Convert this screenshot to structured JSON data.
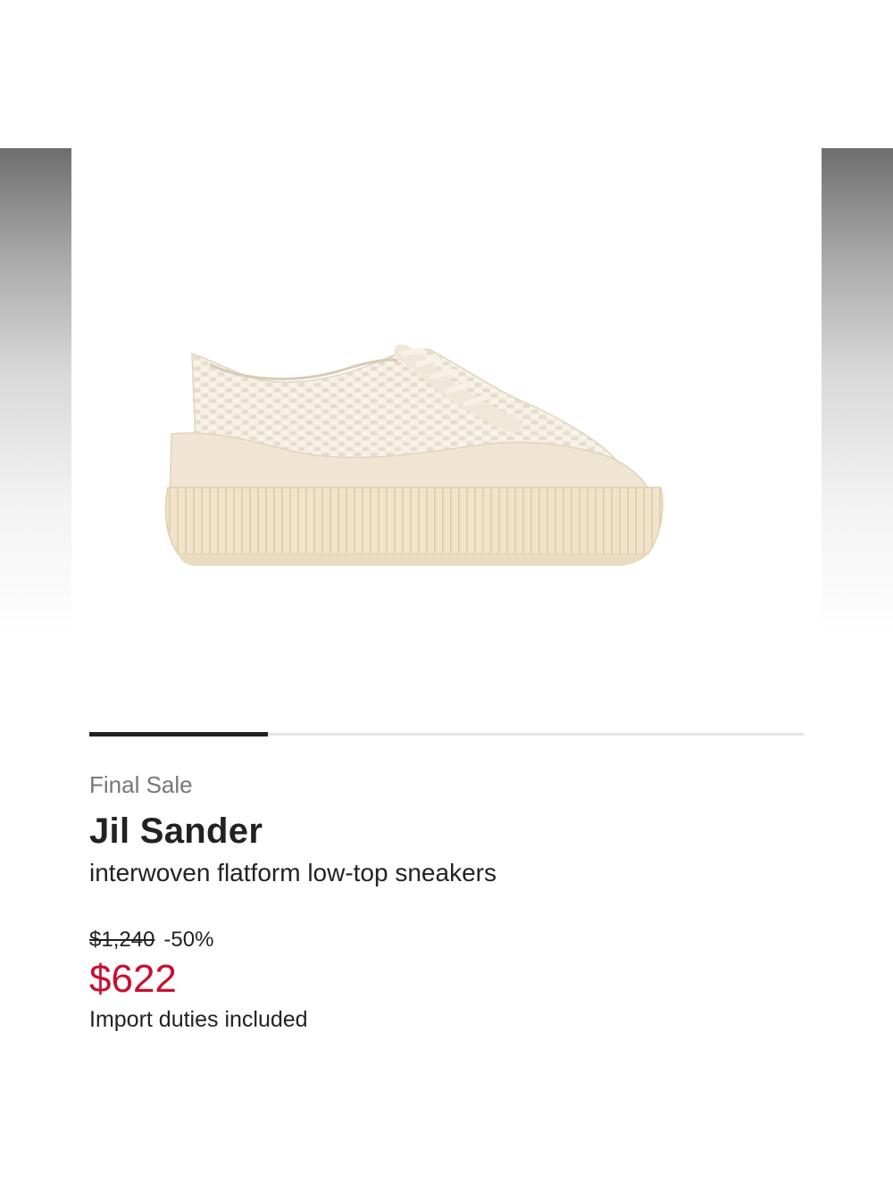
{
  "product": {
    "sale_label": "Final Sale",
    "brand": "Jil Sander",
    "description": "interwoven flatform low-top sneakers",
    "original_price": "$1,240",
    "discount": "-50%",
    "sale_price": "$622",
    "duties_note": "Import duties included",
    "image_icon": "sneaker-photo"
  },
  "carousel": {
    "current_page": 1,
    "total_pages": 4
  },
  "colors": {
    "sale_price": "#c8102e",
    "muted_text": "#777777",
    "text": "#222222",
    "shoe": "#f3ecdd",
    "sole": "#efe2c8"
  }
}
